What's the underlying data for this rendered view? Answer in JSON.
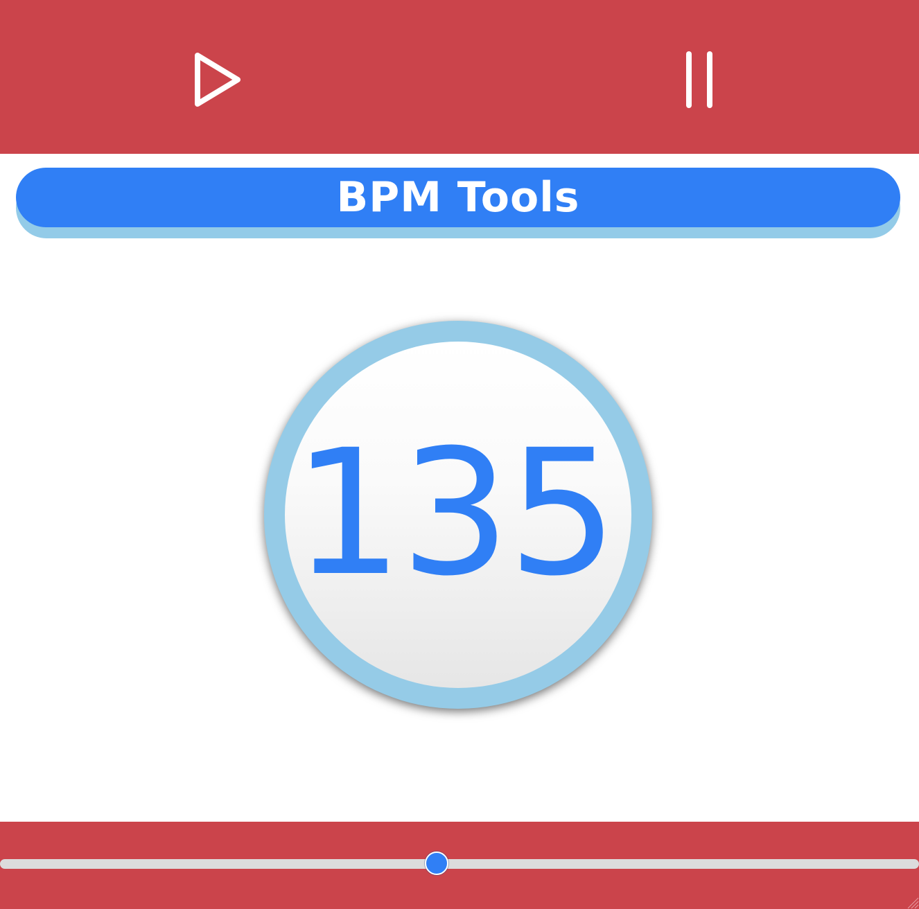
{
  "app": {
    "title": "BPM Tools"
  },
  "transport": {
    "play_icon": "play-icon",
    "pause_icon": "pause-icon"
  },
  "bpm": {
    "value": "135"
  },
  "slider": {
    "position_fraction": 0.475
  },
  "colors": {
    "bar_red": "#cb444b",
    "accent_blue": "#307ff5",
    "ring_light_blue": "#95cbe7",
    "track_gray": "#dcdcdc",
    "background": "#ffffff"
  }
}
